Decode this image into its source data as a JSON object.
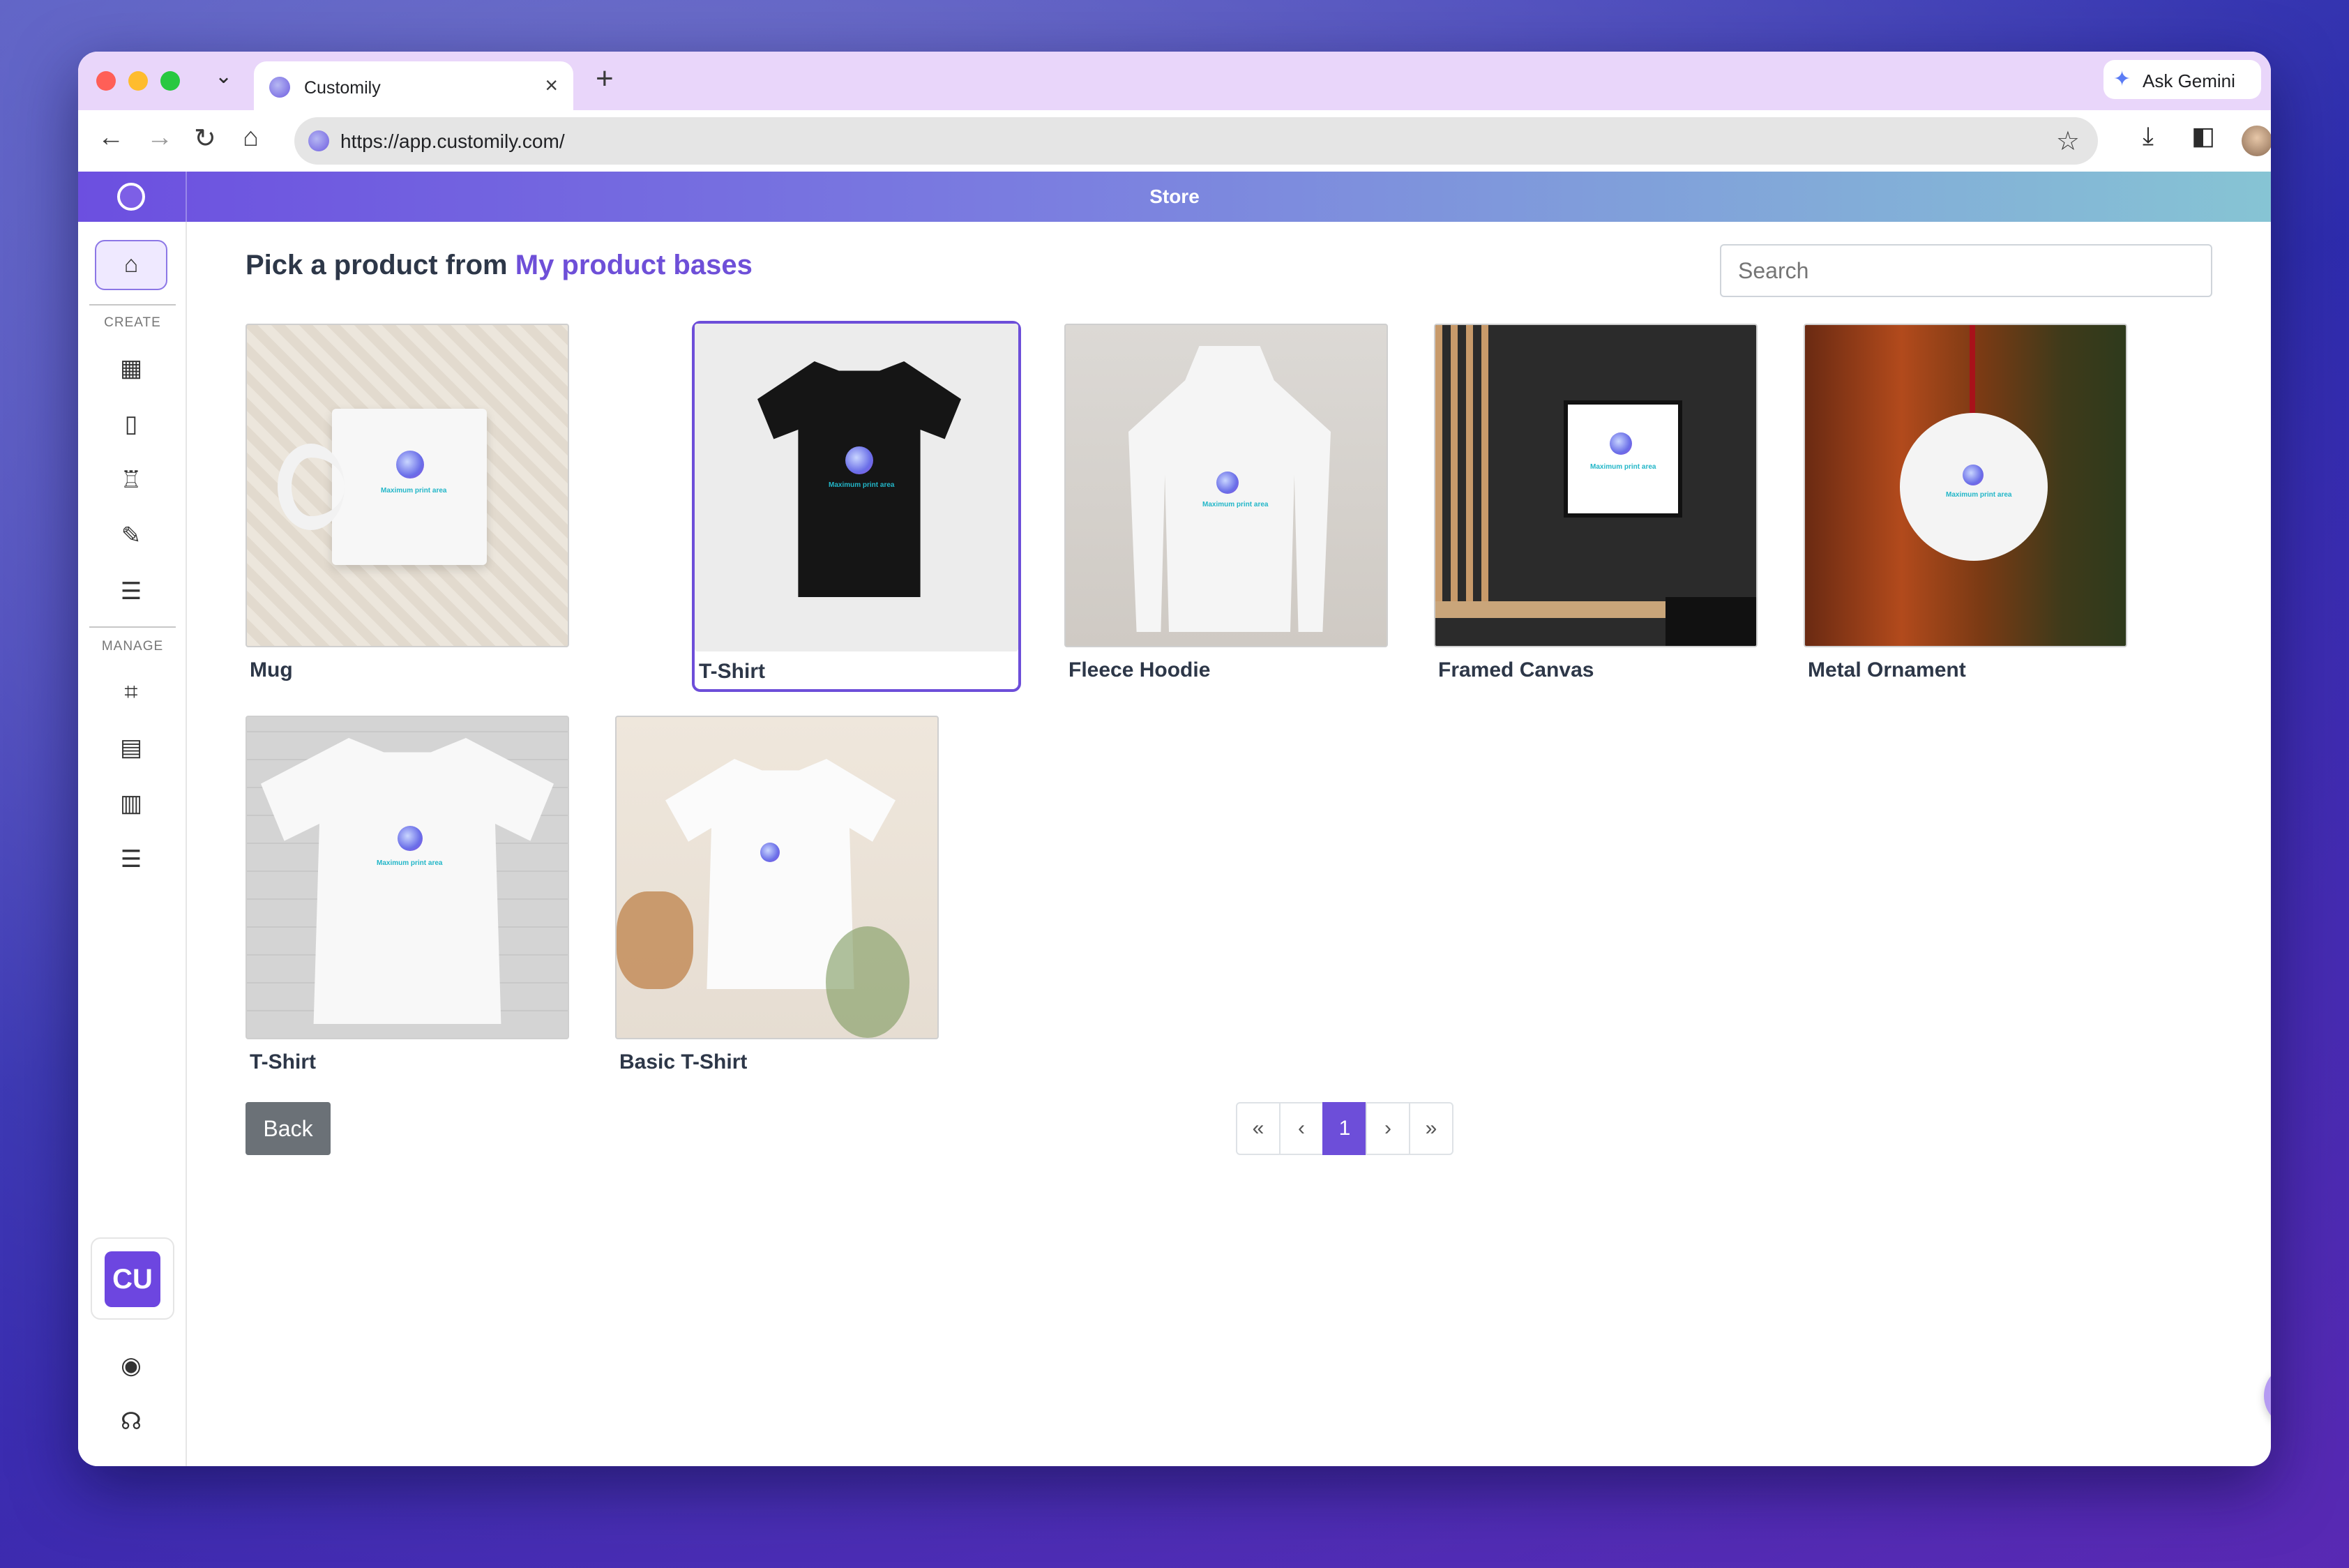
{
  "browser": {
    "tab_title": "Customily",
    "tab_close": "×",
    "new_tab": "+",
    "tab_menu": "⌄",
    "ask_gemini": "Ask Gemini",
    "url": "https://app.customily.com/"
  },
  "app": {
    "header_title": "Store",
    "sidebar": {
      "create_label": "CREATE",
      "manage_label": "MANAGE",
      "avatar_initials": "CU"
    },
    "heading_prefix": "Pick a product from",
    "heading_link": "My product bases",
    "search_placeholder": "Search",
    "products": [
      {
        "label": "Mug",
        "print_text": "Maximum print area"
      },
      {
        "label": "T-Shirt",
        "print_text": "Maximum print area",
        "selected": true
      },
      {
        "label": "Fleece Hoodie",
        "print_text": "Maximum print area"
      },
      {
        "label": "Framed Canvas",
        "print_text": "Maximum print area"
      },
      {
        "label": "Metal Ornament",
        "print_text": "Maximum print area"
      },
      {
        "label": "T-Shirt",
        "print_text": "Maximum print area"
      },
      {
        "label": "Basic T-Shirt",
        "print_text": ""
      }
    ],
    "back_label": "Back",
    "pagination": {
      "first": "«",
      "prev": "‹",
      "current": "1",
      "next": "›",
      "last": "»"
    }
  },
  "colors": {
    "accent": "#6d4ed9",
    "header_gradient_start": "#6c4fe0",
    "header_gradient_end": "#86c4d4",
    "tabstrip": "#e9d6fa"
  }
}
